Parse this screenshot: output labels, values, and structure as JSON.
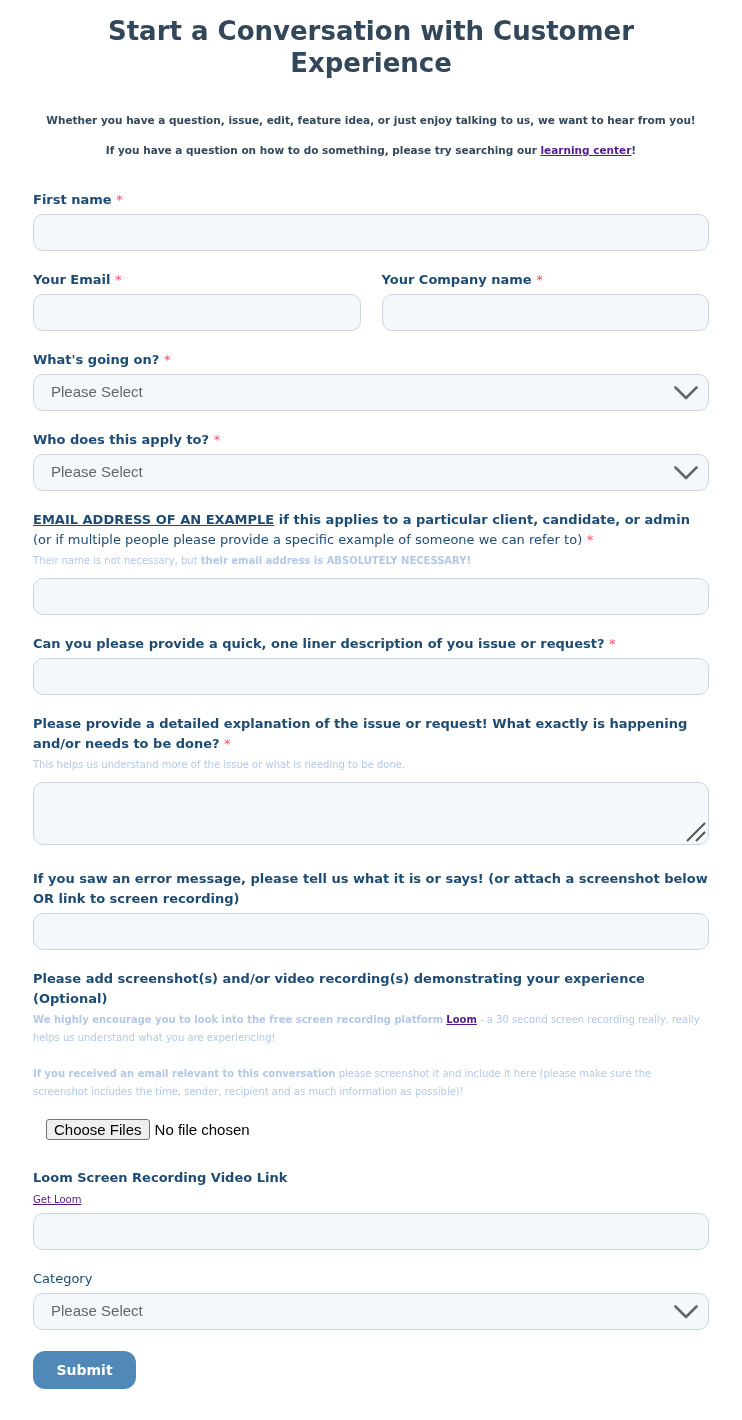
{
  "title": "Start a Conversation with Customer Experience",
  "intro": [
    {
      "text": "Whether you have a question, issue, edit, feature idea, or just enjoy talking to us, we want to hear from you!"
    },
    {
      "text": "If you have a question on how to do something, please try searching our",
      "link": "learning center",
      "after": "!"
    }
  ],
  "fields": [
    {
      "kind": "text",
      "label": "First name",
      "label_bold": true,
      "required_mark": "*"
    },
    {
      "kind": "pair",
      "columns": [
        {
          "kind": "text",
          "label": "Your Email",
          "label_bold": true,
          "required_mark": "*"
        },
        {
          "kind": "text",
          "label": "Your Company name",
          "label_bold": true,
          "required_mark": "*"
        }
      ]
    },
    {
      "kind": "select",
      "label": "What's going on?",
      "label_bold": true,
      "required_mark": "*",
      "value": "Please Select"
    },
    {
      "kind": "select",
      "label": "Who does this apply to?",
      "label_bold": true,
      "required_mark": "*",
      "value": "Please Select"
    },
    {
      "kind": "text",
      "label_lead": "EMAIL ADDRESS OF AN EXAMPLE",
      "label": "if this applies to a particular client, candidate, or admin",
      "label_note": "(or if multiple people please provide a specific example of someone we can refer to)",
      "label_bold": true,
      "required_mark": "*",
      "hints": [
        {
          "text": "Their name is not necessary, but **their email address is ABSOLUTELY NECESSARY!**"
        }
      ]
    },
    {
      "kind": "text",
      "label": "Can you please provide a quick, one liner description of you issue or request?",
      "label_bold": true,
      "required_mark": "*"
    },
    {
      "kind": "textarea",
      "label": "Please provide a detailed explanation of the issue or request! What exactly is happening and/or needs to be done?",
      "label_bold": true,
      "required_mark": "*",
      "hints": [
        {
          "text": "This helps us understand more of the issue or what is needing to be done."
        }
      ]
    },
    {
      "kind": "text",
      "label": "If you saw an error message, please tell us what it is or says! (or attach a screenshot below OR link to screen recording)",
      "label_bold": true
    },
    {
      "kind": "file",
      "label": "Please add screenshot(s) and/or video recording(s) demonstrating your experience (Optional)",
      "label_bold": true,
      "hints": [
        {
          "text": "**We highly encourage you to look into the free screen recording platform**",
          "link": "Loom",
          "after": "- a 30 second screen recording really, really helps us understand what you are experiencing!"
        },
        {
          "text": "**If you received an email relevant to this conversation** please screenshot it and include it here (please make sure the screenshot includes the time, sender, recipient and as much information as possible)!"
        }
      ],
      "button": "Choose Files",
      "status": "No file chosen"
    },
    {
      "kind": "text",
      "label": "Loom Screen Recording Video Link",
      "label_bold": true,
      "link": "Get Loom"
    },
    {
      "kind": "select",
      "label": "Category",
      "label_bold": false,
      "value": "Please Select"
    }
  ],
  "submit": {
    "label": "Submit"
  }
}
